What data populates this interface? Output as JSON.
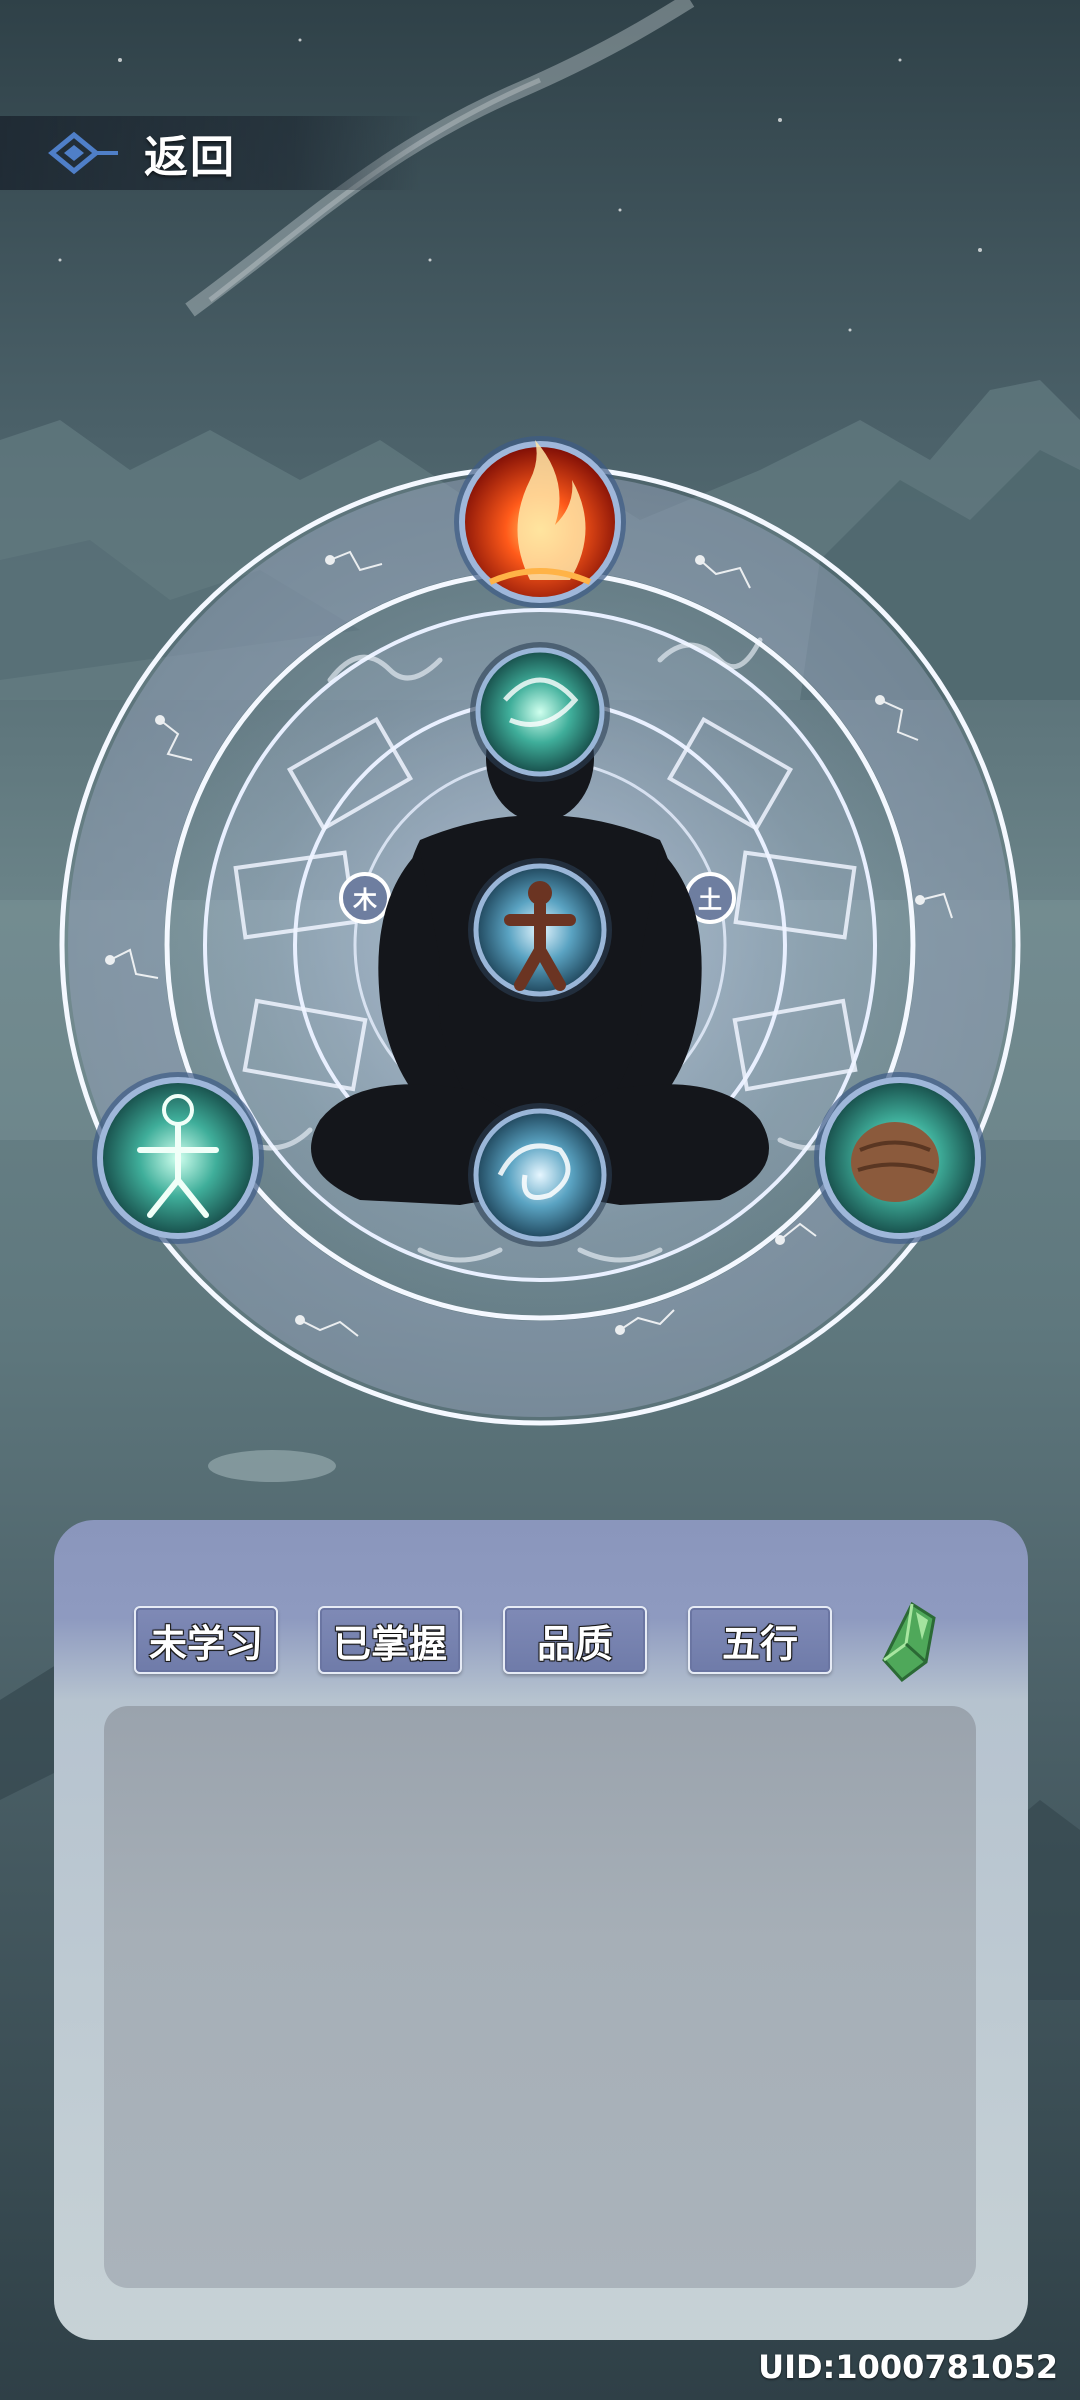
{
  "header": {
    "back_label": "返回"
  },
  "wheel": {
    "left_node_label": "木",
    "right_node_label": "土"
  },
  "skills": [
    {
      "name": "fire-skill-icon"
    },
    {
      "name": "wind-skill-icon"
    },
    {
      "name": "spirit-figure-skill-icon"
    },
    {
      "name": "whirlpool-skill-icon"
    },
    {
      "name": "light-figure-skill-icon"
    },
    {
      "name": "earth-skill-icon"
    }
  ],
  "filters": {
    "tab1": "未学习",
    "tab2": "已掌握",
    "tab3": "品质",
    "tab4": "五行",
    "crystal_icon": "green-crystal-icon"
  },
  "footer": {
    "uid": "UID:1000781052"
  }
}
